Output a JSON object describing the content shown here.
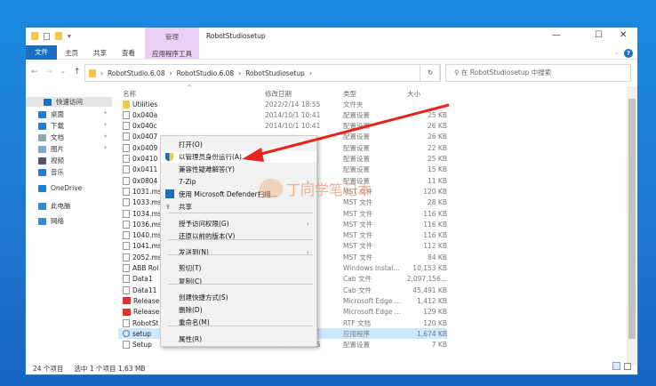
{
  "window": {
    "title": "RobotStudiosetup",
    "manage_tab": "管理",
    "minimize": "—",
    "maximize": "☐",
    "close": "✕"
  },
  "ribbon": {
    "tabs": [
      "文件",
      "主页",
      "共享",
      "查看",
      "应用程序工具"
    ],
    "help": "?"
  },
  "address": {
    "crumbs": [
      "RobotStudio.6.08",
      "RobotStudio.6.08",
      "RobotStudiosetup"
    ],
    "search_placeholder": "在 RobotStudiosetup 中搜索"
  },
  "sidebar": {
    "items": [
      {
        "label": "快速访问",
        "color": "#1a6fc0"
      },
      {
        "label": "桌面",
        "color": "#1a7fd8",
        "pin": true
      },
      {
        "label": "下载",
        "color": "#1a7fd8",
        "pin": true
      },
      {
        "label": "文档",
        "color": "#8aa",
        "pin": true
      },
      {
        "label": "图片",
        "color": "#7aa8d8",
        "pin": true
      },
      {
        "label": "视频",
        "color": "#556"
      },
      {
        "label": "音乐",
        "color": "#1a7fd8"
      },
      {
        "label": "OneDrive",
        "color": "#1a7fd8"
      },
      {
        "label": "此电脑",
        "color": "#2a8ad8"
      },
      {
        "label": "网络",
        "color": "#3a8ad8"
      }
    ]
  },
  "columns": {
    "name": "名称",
    "date": "修改日期",
    "type": "类型",
    "size": "大小"
  },
  "files": [
    {
      "name": "Utilities",
      "date": "2022/2/14 18:55",
      "type": "文件夹",
      "size": ""
    },
    {
      "name": "0x040a",
      "date": "2014/10/1 10:41",
      "type": "配置设置",
      "size": "25 KB"
    },
    {
      "name": "0x040c",
      "date": "2014/10/1 10:41",
      "type": "配置设置",
      "size": "26 KB"
    },
    {
      "name": "0x0407",
      "date": "",
      "type": "配置设置",
      "size": "26 KB"
    },
    {
      "name": "0x0409",
      "date": "",
      "type": "配置设置",
      "size": "22 KB"
    },
    {
      "name": "0x0410",
      "date": "",
      "type": "配置设置",
      "size": "25 KB"
    },
    {
      "name": "0x0411",
      "date": "",
      "type": "配置设置",
      "size": "15 KB"
    },
    {
      "name": "0x0804",
      "date": "",
      "type": "配置设置",
      "size": "11 KB"
    },
    {
      "name": "1031.ms",
      "date": "",
      "type": "MST 文件",
      "size": "120 KB"
    },
    {
      "name": "1033.ms",
      "date": "",
      "type": "MST 文件",
      "size": "28 KB"
    },
    {
      "name": "1034.ms",
      "date": "",
      "type": "MST 文件",
      "size": "116 KB"
    },
    {
      "name": "1036.ms",
      "date": "",
      "type": "MST 文件",
      "size": "116 KB"
    },
    {
      "name": "1040.ms",
      "date": "",
      "type": "MST 文件",
      "size": "116 KB"
    },
    {
      "name": "1041.ms",
      "date": "",
      "type": "MST 文件",
      "size": "112 KB"
    },
    {
      "name": "2052.ms",
      "date": "",
      "type": "MST 文件",
      "size": "84 KB"
    },
    {
      "name": "ABB Rol",
      "date": "",
      "type": "Windows Instal...",
      "size": "10,153 KB"
    },
    {
      "name": "Data1",
      "date": "",
      "type": "Cab 文件",
      "size": "2,097,156..."
    },
    {
      "name": "Data11",
      "date": "",
      "type": "Cab 文件",
      "size": "45,491 KB"
    },
    {
      "name": "Release",
      "date": "",
      "type": "Microsoft Edge ...",
      "size": "1,412 KB"
    },
    {
      "name": "Release",
      "date": "",
      "type": "Microsoft Edge ...",
      "size": "129 KB"
    },
    {
      "name": "RobotSt",
      "date": "",
      "type": "RTF 文档",
      "size": "120 KB"
    },
    {
      "name": "setup",
      "date": "",
      "type": "应用程序",
      "size": "1,674 KB"
    },
    {
      "name": "Setup",
      "date": "2018/10/31 9:56",
      "type": "配置设置",
      "size": "7 KB"
    }
  ],
  "status": {
    "count": "24 个项目",
    "selected": "选中 1 个项目  1.63 MB"
  },
  "context_menu": [
    "打开(O)",
    "以管理员身份运行(A)",
    "兼容性疑难解答(Y)",
    "7-Zip",
    "使用 Microsoft Defender扫描...",
    "共享",
    "授予访问权限(G)",
    "还原以前的版本(V)",
    "发送到(N)",
    "剪切(T)",
    "复制(C)",
    "创建快捷方式(S)",
    "删除(D)",
    "重命名(M)",
    "属性(R)"
  ],
  "watermark": "丁同学笔记本",
  "colors": {
    "accent": "#1a6fc0",
    "selection": "#cce8ff",
    "arrow": "#e8231d"
  }
}
